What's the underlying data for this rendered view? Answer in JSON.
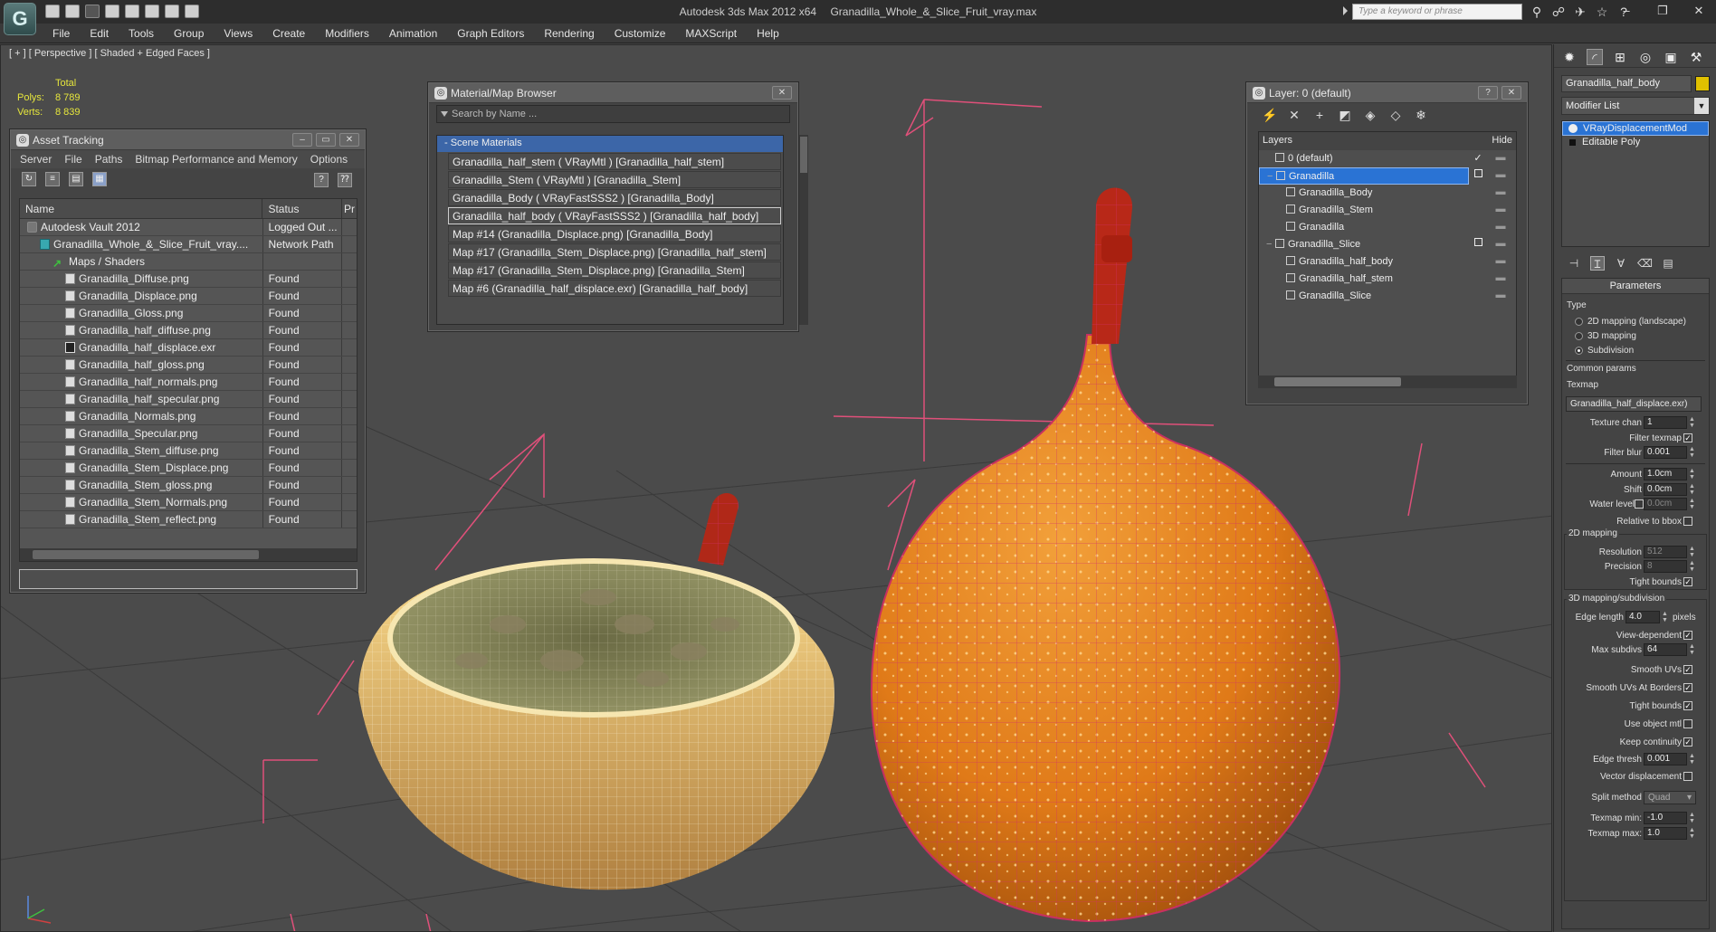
{
  "titlebar": {
    "app_title": "Autodesk 3ds Max  2012 x64",
    "file_title": "Granadilla_Whole_&_Slice_Fruit_vray.max",
    "search_placeholder": "Type a keyword or phrase",
    "logo_letter": "G"
  },
  "menu": [
    "File",
    "Edit",
    "Tools",
    "Group",
    "Views",
    "Create",
    "Modifiers",
    "Animation",
    "Graph Editors",
    "Rendering",
    "Customize",
    "MAXScript",
    "Help"
  ],
  "viewport": {
    "label": "[ + ] [ Perspective ] [ Shaded + Edged Faces ]",
    "stats": {
      "total_label": "Total",
      "polys_label": "Polys:",
      "polys_value": "8 789",
      "verts_label": "Verts:",
      "verts_value": "8 839"
    }
  },
  "asset_tracking": {
    "title": "Asset Tracking",
    "menu": [
      "Server",
      "File",
      "Paths",
      "Bitmap Performance and Memory",
      "Options"
    ],
    "col_name": "Name",
    "col_status": "Status",
    "col_extra": "Pr",
    "rows": [
      {
        "name": "Autodesk Vault 2012",
        "status": "Logged Out ...",
        "indent": 0,
        "icon": "vault"
      },
      {
        "name": "Granadilla_Whole_&_Slice_Fruit_vray....",
        "status": "Network Path",
        "indent": 1,
        "icon": "max"
      },
      {
        "name": "Maps / Shaders",
        "status": "",
        "indent": 2,
        "icon": "folder"
      },
      {
        "name": "Granadilla_Diffuse.png",
        "status": "Found",
        "indent": 3,
        "icon": "file"
      },
      {
        "name": "Granadilla_Displace.png",
        "status": "Found",
        "indent": 3,
        "icon": "file"
      },
      {
        "name": "Granadilla_Gloss.png",
        "status": "Found",
        "indent": 3,
        "icon": "file"
      },
      {
        "name": "Granadilla_half_diffuse.png",
        "status": "Found",
        "indent": 3,
        "icon": "file"
      },
      {
        "name": "Granadilla_half_displace.exr",
        "status": "Found",
        "indent": 3,
        "icon": "exr"
      },
      {
        "name": "Granadilla_half_gloss.png",
        "status": "Found",
        "indent": 3,
        "icon": "file"
      },
      {
        "name": "Granadilla_half_normals.png",
        "status": "Found",
        "indent": 3,
        "icon": "file"
      },
      {
        "name": "Granadilla_half_specular.png",
        "status": "Found",
        "indent": 3,
        "icon": "file"
      },
      {
        "name": "Granadilla_Normals.png",
        "status": "Found",
        "indent": 3,
        "icon": "file"
      },
      {
        "name": "Granadilla_Specular.png",
        "status": "Found",
        "indent": 3,
        "icon": "file"
      },
      {
        "name": "Granadilla_Stem_diffuse.png",
        "status": "Found",
        "indent": 3,
        "icon": "file"
      },
      {
        "name": "Granadilla_Stem_Displace.png",
        "status": "Found",
        "indent": 3,
        "icon": "file"
      },
      {
        "name": "Granadilla_Stem_gloss.png",
        "status": "Found",
        "indent": 3,
        "icon": "file"
      },
      {
        "name": "Granadilla_Stem_Normals.png",
        "status": "Found",
        "indent": 3,
        "icon": "file"
      },
      {
        "name": "Granadilla_Stem_reflect.png",
        "status": "Found",
        "indent": 3,
        "icon": "file"
      }
    ]
  },
  "material_browser": {
    "title": "Material/Map Browser",
    "search_placeholder": "Search by Name ...",
    "group": "- Scene Materials",
    "items": [
      "Granadilla_half_stem  ( VRayMtl )  [Granadilla_half_stem]",
      "Granadilla_Stem  ( VRayMtl )  [Granadilla_Stem]",
      "Granadilla_Body  ( VRayFastSSS2 )  [Granadilla_Body]",
      "Granadilla_half_body  ( VRayFastSSS2 )  [Granadilla_half_body]",
      "Map #14 (Granadilla_Displace.png) [Granadilla_Body]",
      "Map #17 (Granadilla_Stem_Displace.png) [Granadilla_half_stem]",
      "Map #17 (Granadilla_Stem_Displace.png) [Granadilla_Stem]",
      "Map #6 (Granadilla_half_displace.exr) [Granadilla_half_body]"
    ],
    "selected_index": 3
  },
  "layer_dialog": {
    "title": "Layer: 0 (default)",
    "col_layers": "Layers",
    "col_hide": "Hide",
    "rows": [
      {
        "name": "0 (default)",
        "indent": 1,
        "expander": "",
        "check": "✓"
      },
      {
        "name": "Granadilla",
        "indent": 1,
        "expander": "−",
        "check": "box",
        "selected": true
      },
      {
        "name": "Granadilla_Body",
        "indent": 2,
        "expander": "",
        "check": ""
      },
      {
        "name": "Granadilla_Stem",
        "indent": 2,
        "expander": "",
        "check": ""
      },
      {
        "name": "Granadilla",
        "indent": 2,
        "expander": "",
        "check": ""
      },
      {
        "name": "Granadilla_Slice",
        "indent": 1,
        "expander": "−",
        "check": "box"
      },
      {
        "name": "Granadilla_half_body",
        "indent": 2,
        "expander": "",
        "check": ""
      },
      {
        "name": "Granadilla_half_stem",
        "indent": 2,
        "expander": "",
        "check": ""
      },
      {
        "name": "Granadilla_Slice",
        "indent": 2,
        "expander": "",
        "check": ""
      }
    ]
  },
  "command_panel": {
    "object_name": "Granadilla_half_body",
    "object_color": "#e0c000",
    "modifier_list": "Modifier List",
    "stack": [
      "VRayDisplacementMod",
      "Editable Poly"
    ],
    "rollout_title": "Parameters",
    "type_label": "Type",
    "type_options": [
      "2D mapping (landscape)",
      "3D mapping",
      "Subdivision"
    ],
    "type_selected": 2,
    "common_params": "Common params",
    "texmap_label": "Texmap",
    "texmap_value": "Granadilla_half_displace.exr)",
    "texture_chan_label": "Texture chan",
    "texture_chan": "1",
    "filter_texmap_label": "Filter texmap",
    "filter_blur_label": "Filter blur",
    "filter_blur": "0.001",
    "amount_label": "Amount",
    "amount": "1.0cm",
    "shift_label": "Shift",
    "shift": "0.0cm",
    "water_level_label": "Water level",
    "water_level": "0.0cm",
    "relative_bbox_label": "Relative to bbox",
    "mapping2d": "2D mapping",
    "resolution_label": "Resolution",
    "resolution": "512",
    "precision_label": "Precision",
    "precision": "8",
    "tight_bounds_label": "Tight bounds",
    "mapping3d": "3D mapping/subdivision",
    "edge_length_label": "Edge length",
    "edge_length": "4.0",
    "pixels_label": "pixels",
    "view_dependent_label": "View-dependent",
    "max_subdivs_label": "Max subdivs",
    "max_subdivs": "64",
    "smooth_uvs_label": "Smooth UVs",
    "smooth_uvs_borders_label": "Smooth UVs At Borders",
    "tight_bounds2_label": "Tight bounds",
    "use_object_mtl_label": "Use object mtl",
    "keep_continuity_label": "Keep continuity",
    "edge_thresh_label": "Edge thresh",
    "edge_thresh": "0.001",
    "vector_disp_label": "Vector displacement",
    "split_method_label": "Split method",
    "split_method": "Quad",
    "texmap_min_label": "Texmap min:",
    "texmap_min": "-1.0",
    "texmap_max_label": "Texmap max:",
    "texmap_max": "1.0"
  }
}
